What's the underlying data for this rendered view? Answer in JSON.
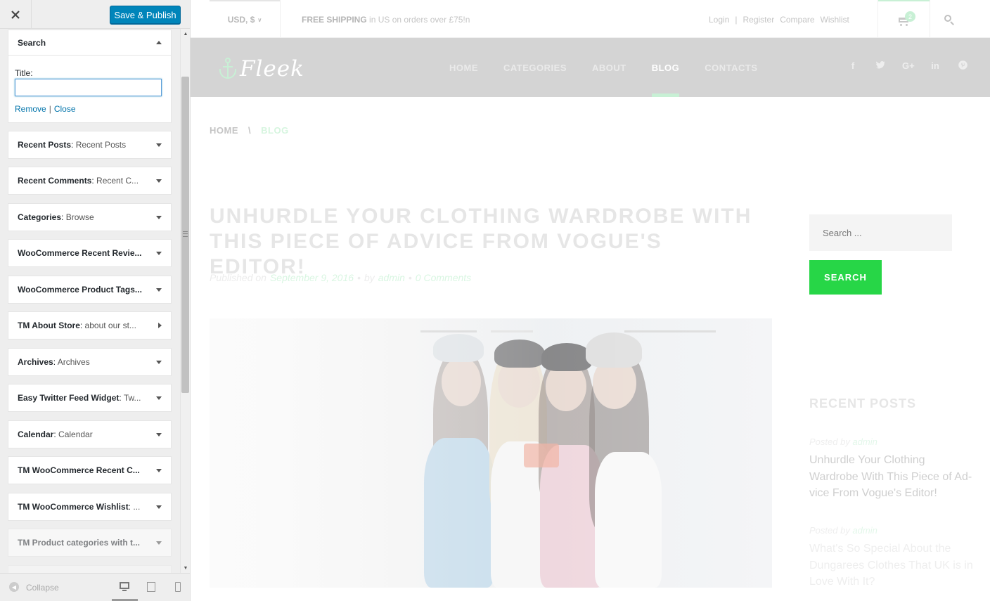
{
  "customizer": {
    "close_icon": "close-icon",
    "publish_label": "Save & Publish",
    "open_widget": {
      "title": "Search",
      "field_label": "Title:",
      "field_value": "",
      "remove_label": "Remove",
      "separator": "|",
      "close_label": "Close"
    },
    "widgets": [
      {
        "type": "Recent Posts",
        "title": "Recent Posts",
        "arrow": "down"
      },
      {
        "type": "Recent Comments",
        "title": "Recent C...",
        "arrow": "down"
      },
      {
        "type": "Categories",
        "title": "Browse",
        "arrow": "down"
      },
      {
        "type": "WooCommerce Recent Revie...",
        "title": "",
        "arrow": "down"
      },
      {
        "type": "WooCommerce Product Tags...",
        "title": "",
        "arrow": "down"
      },
      {
        "type": "TM About Store",
        "title": "about our st...",
        "arrow": "right"
      },
      {
        "type": "Archives",
        "title": "Archives",
        "arrow": "down"
      },
      {
        "type": "Easy Twitter Feed Widget",
        "title": "Tw...",
        "arrow": "down"
      },
      {
        "type": "Calendar",
        "title": "Calendar",
        "arrow": "down"
      },
      {
        "type": "TM WooCommerce Recent C...",
        "title": "",
        "arrow": "down"
      },
      {
        "type": "TM WooCommerce Wishlist",
        "title": "...",
        "arrow": "down"
      },
      {
        "type": "TM Product categories with t...",
        "title": "",
        "arrow": "down"
      }
    ],
    "footer": {
      "collapse_label": "Collapse",
      "devices": [
        "desktop-icon",
        "tablet-icon",
        "mobile-icon"
      ]
    }
  },
  "site": {
    "topbar": {
      "currency": "USD, $",
      "shipping_bold": "FREE SHIPPING",
      "shipping_rest": " in US on orders over £75!n",
      "links": [
        "Login",
        "|",
        "Register",
        "Compare",
        "Wishlist"
      ],
      "cart_count": "2"
    },
    "logo": "Fleek",
    "nav": [
      {
        "label": "HOME",
        "active": false
      },
      {
        "label": "CATEGORIES",
        "active": false
      },
      {
        "label": "ABOUT",
        "active": false
      },
      {
        "label": "BLOG",
        "active": true
      },
      {
        "label": "CONTACTS",
        "active": false
      }
    ],
    "social": [
      "f",
      "t",
      "G+",
      "in",
      "p"
    ],
    "breadcrumb": {
      "home": "HOME",
      "sep": "\\",
      "current": "BLOG"
    },
    "post": {
      "title_line1": "UNHURDLE YOUR CLOTHING WARDROBE WITH",
      "title_line2": "THIS PIECE OF ADVICE FROM VOGUE'S EDITOR!",
      "published_on": "Published on",
      "date": "September 9, 2016",
      "dot": "•",
      "by": "by",
      "author": "admin",
      "comments": "0 Comments"
    },
    "sidebar": {
      "search_placeholder": "Search ...",
      "search_button": "SEARCH",
      "recent_posts_title": "RECENT POSTS",
      "recent_posts": [
        {
          "posted_by": "Posted by",
          "author": "admin",
          "title": "Unhurdle Your Clothing Wardrobe With This Piece of Ad-vice From Vogue's Editor!",
          "color": "#cfcfcf"
        },
        {
          "posted_by": "Posted by",
          "author": "admin",
          "title": "What's So Special About the Dungarees Clothes That UK is in Love With It?",
          "color": "#eeeeee"
        }
      ]
    }
  }
}
